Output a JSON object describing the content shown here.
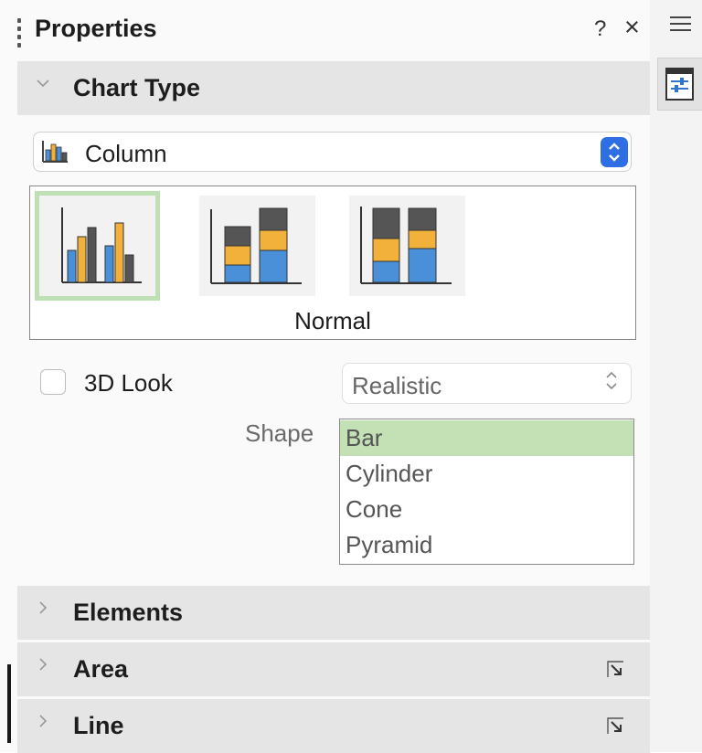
{
  "panel": {
    "title": "Properties",
    "help": "?",
    "close": "×"
  },
  "sections": {
    "chart_type": {
      "label": "Chart Type",
      "expanded": true
    },
    "elements": {
      "label": "Elements"
    },
    "area": {
      "label": "Area"
    },
    "line": {
      "label": "Line"
    }
  },
  "chart_type": {
    "selected_type": "Column",
    "variants": [
      "Normal",
      "Stacked",
      "Percent Stacked"
    ],
    "selected_variant": "Normal",
    "look3d_label": "3D Look",
    "look3d_checked": false,
    "scheme": "Realistic",
    "shape_label": "Shape",
    "shapes": [
      "Bar",
      "Cylinder",
      "Cone",
      "Pyramid"
    ],
    "selected_shape": "Bar"
  },
  "colors": {
    "accent": "#2f6fe4",
    "selection": "#c3e1b4",
    "header": "#e5e5e5"
  }
}
